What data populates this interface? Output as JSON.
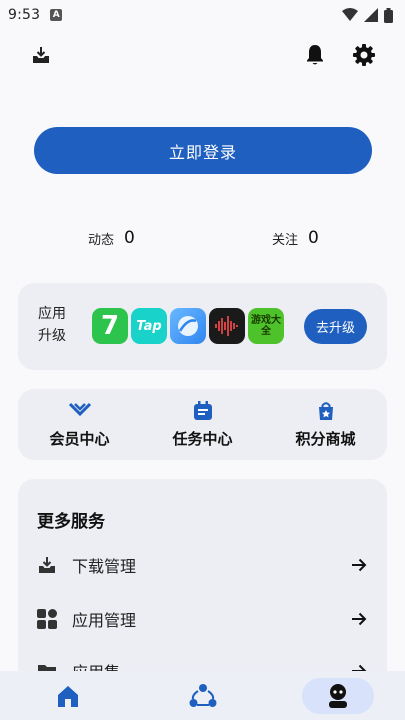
{
  "status_bar": {
    "time": "9:53",
    "badge": "A"
  },
  "login": {
    "label": "立即登录"
  },
  "stats": [
    {
      "label": "动态",
      "value": "0"
    },
    {
      "label": "关注",
      "value": "0"
    }
  ],
  "apps_card": {
    "title": "应用升级",
    "icons": [
      {
        "name": "seven-app-icon",
        "text": "7"
      },
      {
        "name": "taptap-app-icon",
        "text": "Tap"
      },
      {
        "name": "browser-app-icon",
        "text": ""
      },
      {
        "name": "recorder-app-icon",
        "text": ""
      },
      {
        "name": "game-center-app-icon",
        "text": "游戏大全"
      }
    ],
    "upgrade_label": "去升级"
  },
  "centers": [
    {
      "label": "会员中心",
      "icon": "vip-icon"
    },
    {
      "label": "任务中心",
      "icon": "task-icon"
    },
    {
      "label": "积分商城",
      "icon": "points-mall-icon"
    }
  ],
  "more_services": {
    "title": "更多服务",
    "items": [
      {
        "label": "下载管理",
        "icon": "download-tray-icon"
      },
      {
        "label": "应用管理",
        "icon": "apps-grid-icon"
      },
      {
        "label": "应用集",
        "icon": "folder-icon"
      }
    ]
  },
  "colors": {
    "primary": "#1f5fbf",
    "card": "#edeef3",
    "nav": "#eceff6",
    "nav_active": "#d8e2fb"
  }
}
